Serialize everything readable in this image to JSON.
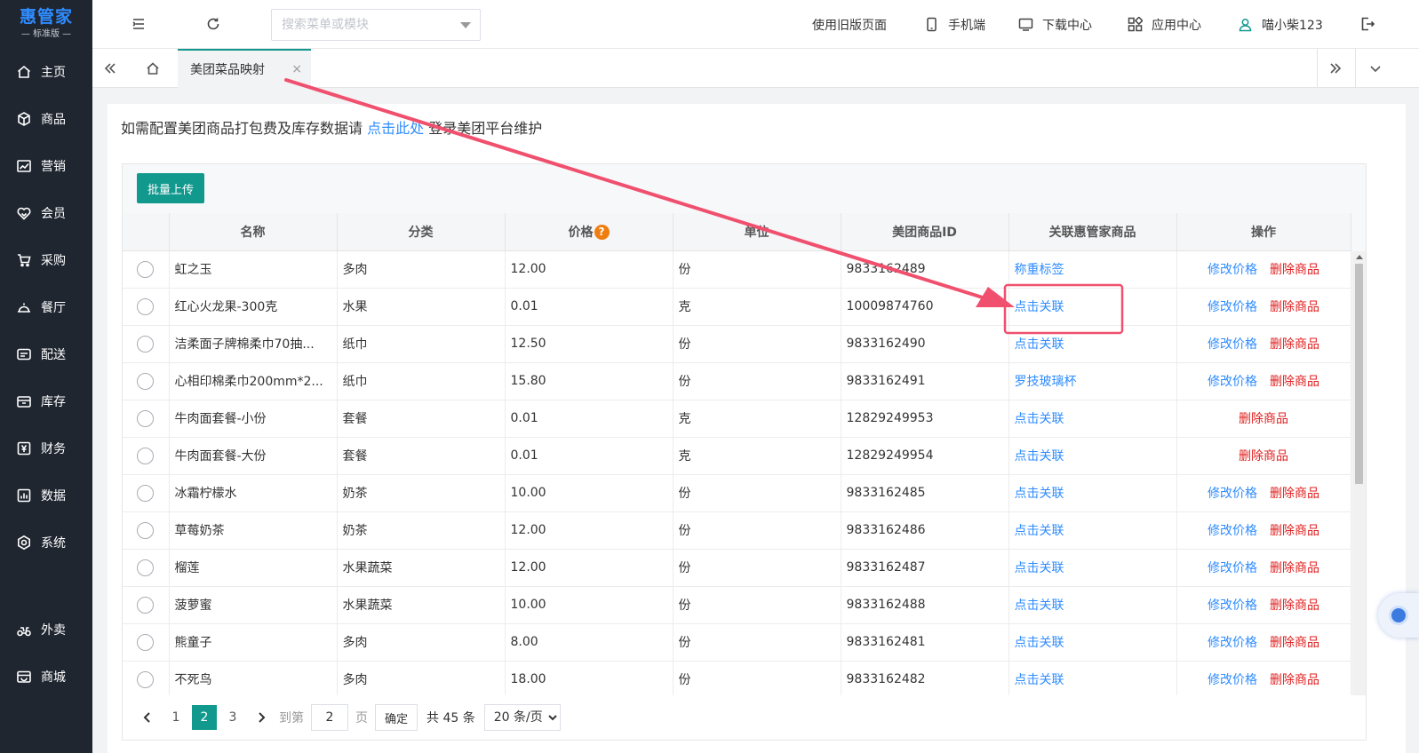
{
  "brand": {
    "name": "惠管家",
    "edition": "标准版"
  },
  "sidebar": {
    "items": [
      {
        "label": "主页",
        "icon": "home-icon"
      },
      {
        "label": "商品",
        "icon": "cube-icon"
      },
      {
        "label": "营销",
        "icon": "chart-icon"
      },
      {
        "label": "会员",
        "icon": "heart-icon"
      },
      {
        "label": "采购",
        "icon": "cart-icon"
      },
      {
        "label": "餐厅",
        "icon": "cloche-icon"
      },
      {
        "label": "配送",
        "icon": "truck-icon"
      },
      {
        "label": "库存",
        "icon": "storage-icon"
      },
      {
        "label": "财务",
        "icon": "yen-icon"
      },
      {
        "label": "数据",
        "icon": "bar-chart-icon"
      },
      {
        "label": "系统",
        "icon": "settings-icon"
      },
      {
        "label": "外卖",
        "icon": "scooter-icon"
      },
      {
        "label": "商城",
        "icon": "shop-icon"
      }
    ]
  },
  "header": {
    "search_placeholder": "搜索菜单或模块",
    "old_version": "使用旧版页面",
    "mobile": "手机端",
    "download": "下载中心",
    "apps": "应用中心",
    "user": "喵小柴123"
  },
  "tabs": {
    "active": "美团菜品映射"
  },
  "notice": {
    "before": "如需配置美团商品打包费及库存数据请 ",
    "link": "点击此处",
    "after": " 登录美团平台维护"
  },
  "toolbar": {
    "batch_upload": "批量上传"
  },
  "table": {
    "headers": [
      "名称",
      "分类",
      "价格",
      "单位",
      "美团商品ID",
      "关联惠管家商品",
      "操作"
    ],
    "price_help": "?",
    "edit_label": "修改价格",
    "delete_label": "删除商品",
    "rows": [
      {
        "name": "虹之玉",
        "category": "多肉",
        "price": "12.00",
        "unit": "份",
        "mt_id": "9833162489",
        "linked": "称重标签",
        "editable": true
      },
      {
        "name": "红心火龙果-300克",
        "category": "水果",
        "price": "0.01",
        "unit": "克",
        "mt_id": "10009874760",
        "linked": "点击关联",
        "editable": true
      },
      {
        "name": "洁柔面子牌棉柔巾70抽...",
        "category": "纸巾",
        "price": "12.50",
        "unit": "份",
        "mt_id": "9833162490",
        "linked": "点击关联",
        "editable": true
      },
      {
        "name": "心相印棉柔巾200mm*2...",
        "category": "纸巾",
        "price": "15.80",
        "unit": "份",
        "mt_id": "9833162491",
        "linked": "罗技玻璃杯",
        "editable": true
      },
      {
        "name": "牛肉面套餐-小份",
        "category": "套餐",
        "price": "0.01",
        "unit": "克",
        "mt_id": "12829249953",
        "linked": "点击关联",
        "editable": false
      },
      {
        "name": "牛肉面套餐-大份",
        "category": "套餐",
        "price": "0.01",
        "unit": "克",
        "mt_id": "12829249954",
        "linked": "点击关联",
        "editable": false
      },
      {
        "name": "冰霜柠檬水",
        "category": "奶茶",
        "price": "10.00",
        "unit": "份",
        "mt_id": "9833162485",
        "linked": "点击关联",
        "editable": true
      },
      {
        "name": "草莓奶茶",
        "category": "奶茶",
        "price": "12.00",
        "unit": "份",
        "mt_id": "9833162486",
        "linked": "点击关联",
        "editable": true
      },
      {
        "name": "榴莲",
        "category": "水果蔬菜",
        "price": "12.00",
        "unit": "份",
        "mt_id": "9833162487",
        "linked": "点击关联",
        "editable": true
      },
      {
        "name": "菠萝蜜",
        "category": "水果蔬菜",
        "price": "10.00",
        "unit": "份",
        "mt_id": "9833162488",
        "linked": "点击关联",
        "editable": true
      },
      {
        "name": "熊童子",
        "category": "多肉",
        "price": "8.00",
        "unit": "份",
        "mt_id": "9833162481",
        "linked": "点击关联",
        "editable": true
      },
      {
        "name": "不死鸟",
        "category": "多肉",
        "price": "18.00",
        "unit": "份",
        "mt_id": "9833162482",
        "linked": "点击关联",
        "editable": true
      }
    ]
  },
  "pagination": {
    "pages": [
      "1",
      "2",
      "3"
    ],
    "current": "2",
    "goto_label": "到第",
    "goto_value": "2",
    "page_unit": "页",
    "confirm": "确定",
    "total": "共 45 条",
    "page_size": "20 条/页"
  },
  "colors": {
    "accent": "#12998e",
    "link": "#2f8cff",
    "danger": "#e02020",
    "annotation": "#f0506e",
    "sidebar_bg": "#1f2630"
  }
}
